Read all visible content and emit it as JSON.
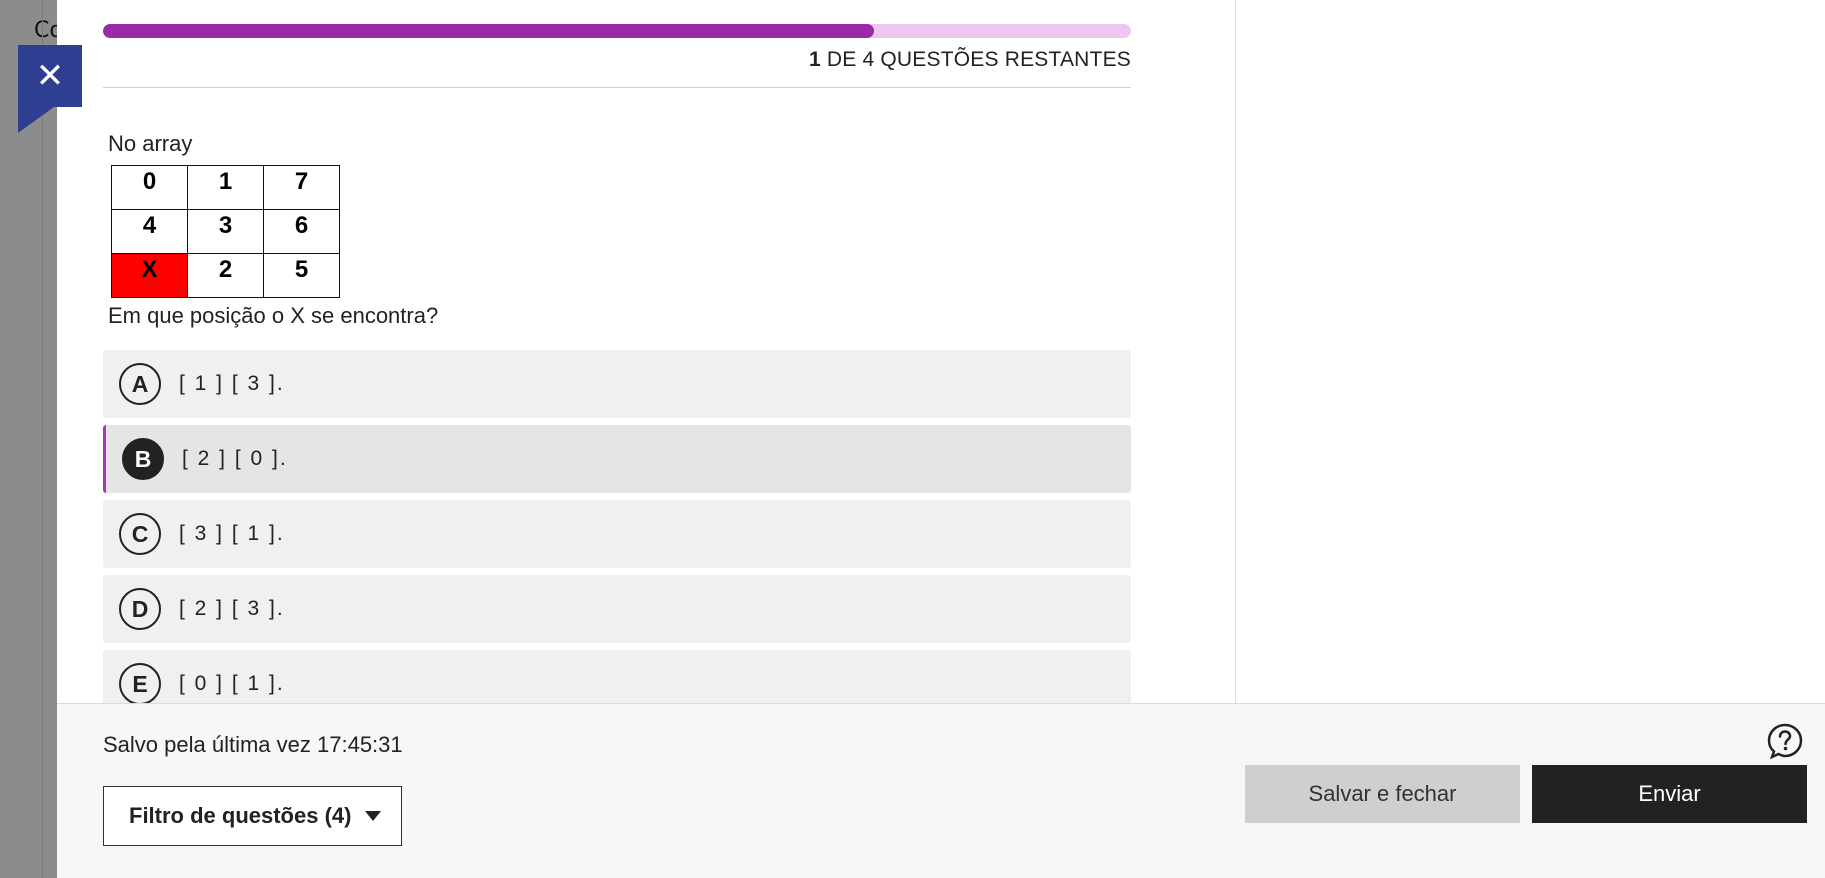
{
  "background": {
    "partial_text": "Co"
  },
  "close_button": {
    "icon": "close-icon",
    "glyph": "✕"
  },
  "progress": {
    "fraction": 0.75,
    "current": "1",
    "rest": " DE 4 QUESTÕES RESTANTES",
    "colors": {
      "fill": "#9b2aa8",
      "track": "#ecc8f0"
    }
  },
  "question": {
    "intro": "No array",
    "grid": [
      [
        "0",
        "1",
        "7"
      ],
      [
        "4",
        "3",
        "6"
      ],
      [
        "X",
        "2",
        "5"
      ]
    ],
    "highlight_cell": "X",
    "prompt": "Em que posição o X se encontra?"
  },
  "options": [
    {
      "letter": "A",
      "text": "[ 1 ] [ 3 ].",
      "selected": false
    },
    {
      "letter": "B",
      "text": "[ 2 ] [ 0 ].",
      "selected": true
    },
    {
      "letter": "C",
      "text": "[ 3 ] [ 1 ].",
      "selected": false
    },
    {
      "letter": "D",
      "text": "[ 2 ] [ 3 ].",
      "selected": false
    },
    {
      "letter": "E",
      "text": "[ 0 ] [ 1 ].",
      "selected": false
    }
  ],
  "footer": {
    "saved_text": "Salvo pela última vez 17:45:31",
    "filter_label": "Filtro de questões (4)",
    "help_icon": "help-question-icon",
    "save_close_label": "Salvar e fechar",
    "send_label": "Enviar"
  }
}
